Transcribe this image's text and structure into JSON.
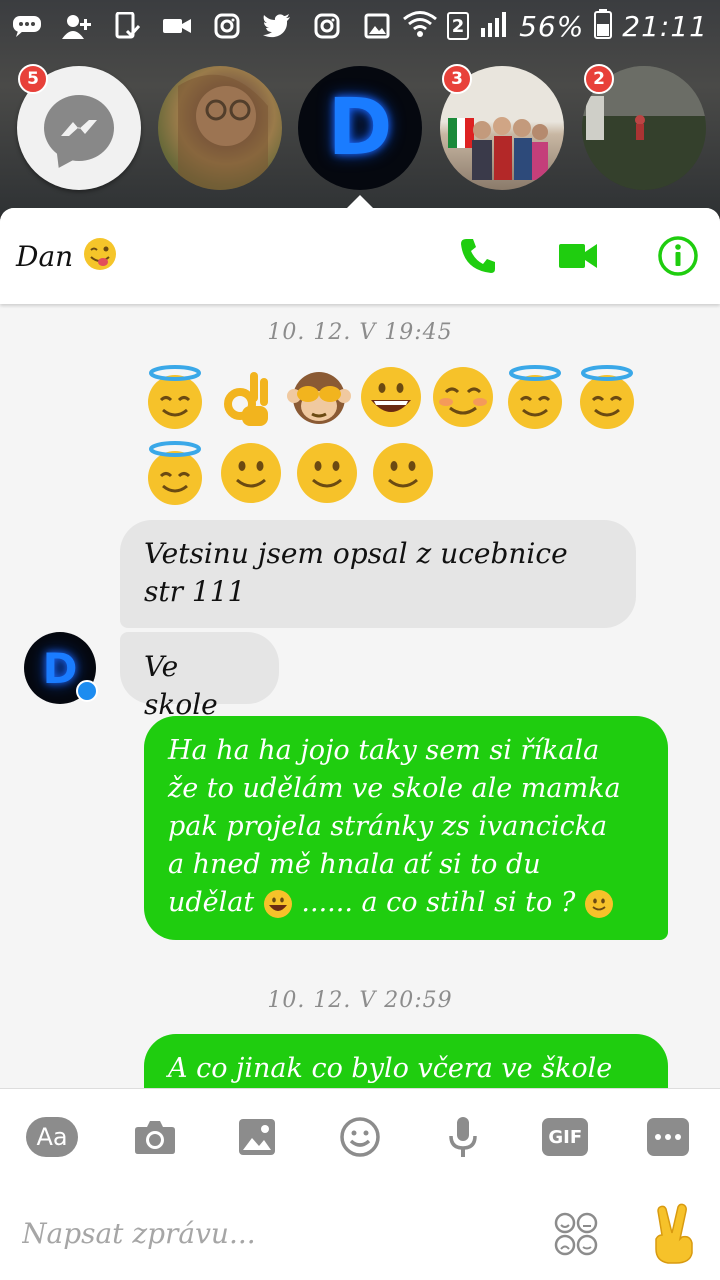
{
  "status_bar": {
    "sim_label": "2",
    "battery_text": "56%",
    "time": "21:11"
  },
  "chat_heads": {
    "badges": [
      "5",
      "3",
      "2"
    ],
    "monogram": "D"
  },
  "header": {
    "contact_name": "Dan",
    "accent_color": "#1fcd0f"
  },
  "messages": {
    "timestamp_1": "10. 12. V 19:45",
    "emoji_row_1": [
      "halo-smile",
      "ok-hand",
      "see-no-evil-monkey",
      "grinning",
      "blush",
      "halo-smile",
      "halo-smile"
    ],
    "emoji_row_2": [
      "halo-smile",
      "slight-smile",
      "slight-smile",
      "slight-smile"
    ],
    "incoming_1": "Vetsinu jsem opsal z ucebnice str 111",
    "incoming_2": "Ve skole",
    "outgoing_1_lines": [
      "Ha ha ha jojo taky sem si říkala",
      "že to udělám ve skole ale mamka",
      "pak projela stránky zs ivancicka",
      "a hned mě hnala ať si to du",
      "udělat"
    ],
    "outgoing_1_tail_mid": "...... a co stihl si to ?",
    "timestamp_2": "10. 12. V 20:59",
    "outgoing_2": "A co jinak co bylo včera ve škole"
  },
  "composer": {
    "aa_label": "Aa",
    "gif_label": "GIF",
    "placeholder": "Napsat zprávu..."
  }
}
